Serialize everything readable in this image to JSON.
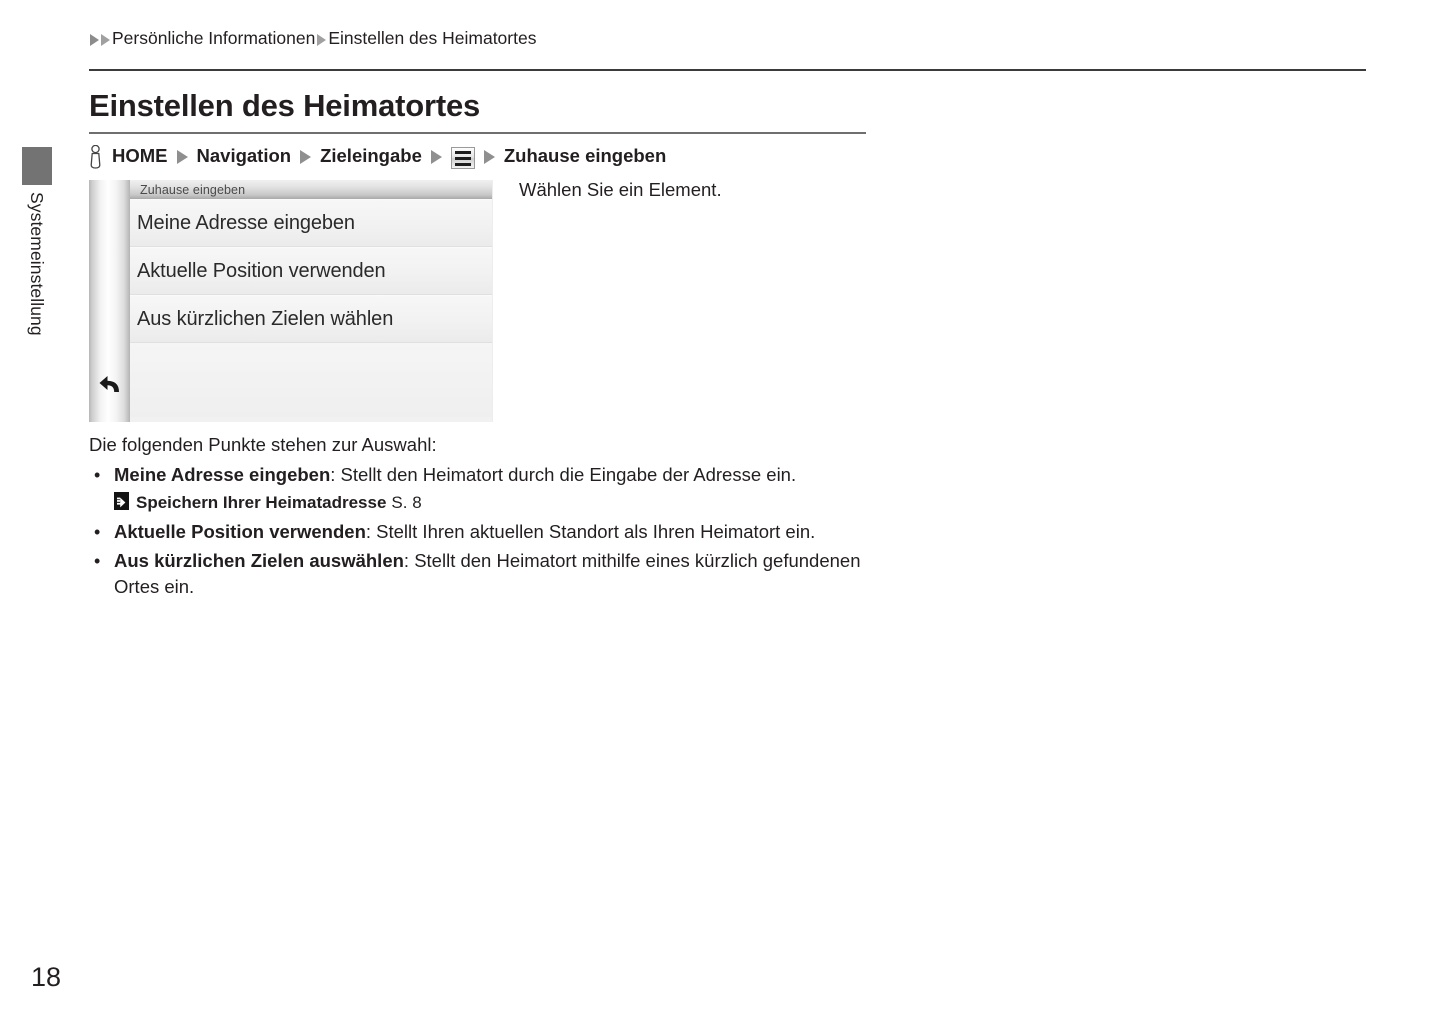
{
  "breadcrumb": {
    "leading_icon": "triangle-right-icon",
    "items": [
      "Persönliche Informationen",
      "Einstellen des Heimatortes"
    ]
  },
  "page": {
    "title": "Einstellen des Heimatortes",
    "number": "18"
  },
  "sidebar": {
    "section_label": "Systemeinstellung",
    "tab_color": "#737373"
  },
  "operation_path": {
    "press_icon": "hand-press-icon",
    "steps": [
      "HOME",
      "Navigation",
      "Zieleingabe"
    ],
    "menu_icon": "hamburger-menu-icon",
    "final_step": "Zuhause eingeben"
  },
  "instruction": "Wählen Sie ein Element.",
  "nav_screen": {
    "title": "Zuhause eingeben",
    "back_icon": "back-arrow-icon",
    "rows": [
      "Meine Adresse eingeben",
      "Aktuelle Position verwenden",
      "Aus kürzlichen Zielen wählen"
    ]
  },
  "body": {
    "intro": "Die folgenden Punkte stehen zur Auswahl:",
    "bullet_char": "•",
    "items": [
      {
        "term": "Meine Adresse eingeben",
        "description": ": Stellt den Heimatort durch die Eingabe der Adresse ein.",
        "xref": {
          "icon": "reference-arrow-icon",
          "title": "Speichern Ihrer Heimatadresse",
          "page": "S. 8"
        }
      },
      {
        "term": "Aktuelle Position verwenden",
        "description": ": Stellt Ihren aktuellen Standort als Ihren Heimatort ein."
      },
      {
        "term": "Aus kürzlichen Zielen auswählen",
        "description": ": Stellt den Heimatort mithilfe eines kürzlich gefundenen Ortes ein."
      }
    ]
  }
}
